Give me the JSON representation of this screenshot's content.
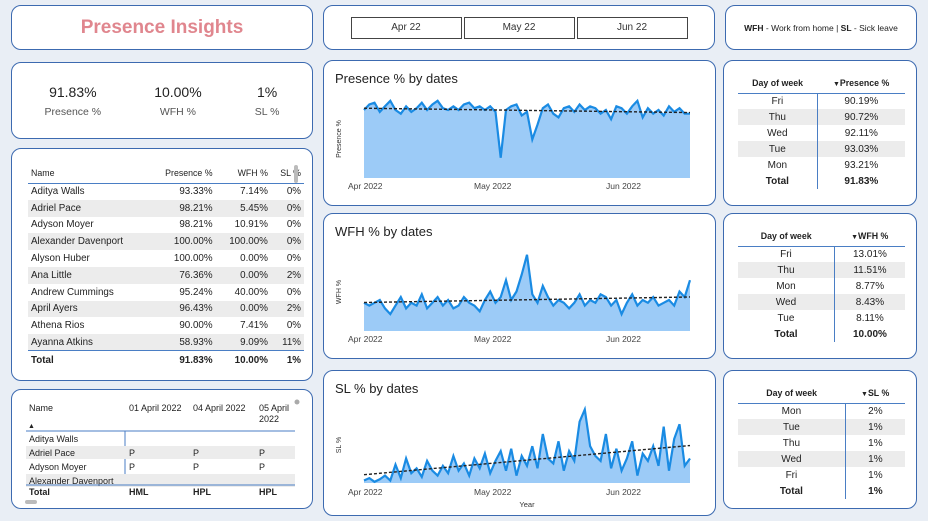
{
  "title": "Presence Insights",
  "slicer": [
    "Apr 22",
    "May 22",
    "Jun 22"
  ],
  "legend": {
    "wfh_code": "WFH",
    "wfh_text": " - Work from home | ",
    "sl_code": "SL",
    "sl_text": " - Sick leave"
  },
  "kpis": [
    {
      "value": "91.83%",
      "label": "Presence %"
    },
    {
      "value": "10.00%",
      "label": "WFH %"
    },
    {
      "value": "1%",
      "label": "SL %"
    }
  ],
  "name_table": {
    "columns": [
      "Name",
      "Presence %",
      "WFH %",
      "SL %"
    ],
    "rows": [
      [
        "Aditya Walls",
        "93.33%",
        "7.14%",
        "0%"
      ],
      [
        "Adriel Pace",
        "98.21%",
        "5.45%",
        "0%"
      ],
      [
        "Adyson Moyer",
        "98.21%",
        "10.91%",
        "0%"
      ],
      [
        "Alexander Davenport",
        "100.00%",
        "100.00%",
        "0%"
      ],
      [
        "Alyson Huber",
        "100.00%",
        "0.00%",
        "0%"
      ],
      [
        "Ana Little",
        "76.36%",
        "0.00%",
        "2%"
      ],
      [
        "Andrew Cummings",
        "95.24%",
        "40.00%",
        "0%"
      ],
      [
        "April Ayers",
        "96.43%",
        "0.00%",
        "2%"
      ],
      [
        "Athena Rios",
        "90.00%",
        "7.41%",
        "0%"
      ],
      [
        "Ayanna Atkins",
        "58.93%",
        "9.09%",
        "11%"
      ]
    ],
    "total": [
      "Total",
      "91.83%",
      "10.00%",
      "1%"
    ]
  },
  "matrix": {
    "columns": [
      "Name",
      "01 April 2022",
      "04 April 2022",
      "05 April 2022"
    ],
    "rows": [
      [
        "Aditya Walls",
        "",
        "",
        ""
      ],
      [
        "Adriel Pace",
        "P",
        "P",
        "P"
      ],
      [
        "Adyson Moyer",
        "P",
        "P",
        "P"
      ],
      [
        "Alexander Davenport",
        "",
        "",
        ""
      ]
    ],
    "total": [
      "Total",
      "HML",
      "HPL",
      "HPL"
    ]
  },
  "charts": {
    "presence": {
      "title": "Presence % by dates",
      "ylabel": "Presence %",
      "xticks": [
        "Apr 2022",
        "May 2022",
        "Jun 2022"
      ]
    },
    "wfh": {
      "title": "WFH % by dates",
      "ylabel": "WFH %",
      "xticks": [
        "Apr 2022",
        "May 2022",
        "Jun 2022"
      ]
    },
    "sl": {
      "title": "SL % by dates",
      "ylabel": "SL %",
      "xlabel": "Year",
      "xticks": [
        "Apr 2022",
        "May 2022",
        "Jun 2022"
      ]
    }
  },
  "dow_tables": {
    "presence": {
      "headers": [
        "Day of week",
        "Presence %"
      ],
      "rows": [
        [
          "Fri",
          "90.19%"
        ],
        [
          "Thu",
          "90.72%"
        ],
        [
          "Wed",
          "92.11%"
        ],
        [
          "Tue",
          "93.03%"
        ],
        [
          "Mon",
          "93.21%"
        ]
      ],
      "total": [
        "Total",
        "91.83%"
      ]
    },
    "wfh": {
      "headers": [
        "Day of week",
        "WFH %"
      ],
      "rows": [
        [
          "Fri",
          "13.01%"
        ],
        [
          "Thu",
          "11.51%"
        ],
        [
          "Mon",
          "8.77%"
        ],
        [
          "Wed",
          "8.43%"
        ],
        [
          "Tue",
          "8.11%"
        ]
      ],
      "total": [
        "Total",
        "10.00%"
      ]
    },
    "sl": {
      "headers": [
        "Day of week",
        "SL %"
      ],
      "rows": [
        [
          "Mon",
          "2%"
        ],
        [
          "Tue",
          "1%"
        ],
        [
          "Thu",
          "1%"
        ],
        [
          "Wed",
          "1%"
        ],
        [
          "Fri",
          "1%"
        ]
      ],
      "total": [
        "Total",
        "1%"
      ]
    }
  },
  "chart_data": [
    {
      "type": "area",
      "title": "Presence % by dates",
      "ylabel": "Presence %",
      "x": [
        "Apr 2022",
        "May 2022",
        "Jun 2022"
      ],
      "series": [
        {
          "values": [
            0.92,
            0.95,
            0.96,
            0.91,
            0.94,
            0.97,
            0.92,
            0.9,
            0.94,
            0.91,
            0.93,
            0.96,
            0.92,
            0.95,
            0.97,
            0.93,
            0.92,
            0.94,
            0.92,
            0.95,
            0.96,
            0.93,
            0.94,
            0.92,
            0.94,
            0.91,
            0.66,
            0.92,
            0.94,
            0.95,
            0.89,
            0.91,
            0.76,
            0.84,
            0.93,
            0.95,
            0.9,
            0.88,
            0.93,
            0.94,
            0.91,
            0.95,
            0.92,
            0.94,
            0.93,
            0.9,
            0.92,
            0.87,
            0.94,
            0.93,
            0.9,
            0.94,
            0.97,
            0.88,
            0.93,
            0.9,
            0.92,
            0.89,
            0.94,
            0.91,
            0.93,
            0.9,
            0.9
          ]
        }
      ],
      "trendline": "dashed"
    },
    {
      "type": "area",
      "title": "WFH % by dates",
      "ylabel": "WFH %",
      "x": [
        "Apr 2022",
        "May 2022",
        "Jun 2022"
      ],
      "series": [
        {
          "values": [
            0.1,
            0.09,
            0.1,
            0.11,
            0.08,
            0.06,
            0.09,
            0.12,
            0.08,
            0.1,
            0.09,
            0.13,
            0.08,
            0.1,
            0.12,
            0.09,
            0.11,
            0.08,
            0.09,
            0.12,
            0.1,
            0.09,
            0.07,
            0.11,
            0.14,
            0.1,
            0.12,
            0.18,
            0.11,
            0.14,
            0.2,
            0.27,
            0.13,
            0.1,
            0.16,
            0.12,
            0.09,
            0.11,
            0.1,
            0.08,
            0.1,
            0.13,
            0.09,
            0.11,
            0.1,
            0.13,
            0.12,
            0.09,
            0.11,
            0.06,
            0.1,
            0.13,
            0.09,
            0.11,
            0.1,
            0.12,
            0.09,
            0.1,
            0.11,
            0.09,
            0.14,
            0.12,
            0.18
          ]
        }
      ],
      "trendline": "dashed"
    },
    {
      "type": "area",
      "title": "SL % by dates",
      "ylabel": "SL %",
      "xlabel": "Year",
      "x": [
        "Apr 2022",
        "May 2022",
        "Jun 2022"
      ],
      "series": [
        {
          "values": [
            0.002,
            0.004,
            0.001,
            0.003,
            0.006,
            0.002,
            0.015,
            0.004,
            0.02,
            0.008,
            0.012,
            0.005,
            0.018,
            0.01,
            0.006,
            0.014,
            0.008,
            0.022,
            0.01,
            0.016,
            0.006,
            0.02,
            0.012,
            0.024,
            0.008,
            0.018,
            0.026,
            0.01,
            0.028,
            0.006,
            0.022,
            0.014,
            0.03,
            0.012,
            0.04,
            0.02,
            0.016,
            0.034,
            0.01,
            0.026,
            0.018,
            0.05,
            0.06,
            0.03,
            0.022,
            0.018,
            0.04,
            0.012,
            0.028,
            0.01,
            0.02,
            0.034,
            0.006,
            0.024,
            0.018,
            0.03,
            0.014,
            0.046,
            0.01,
            0.036,
            0.048,
            0.014,
            0.02
          ]
        }
      ],
      "trendline": "dashed"
    }
  ]
}
